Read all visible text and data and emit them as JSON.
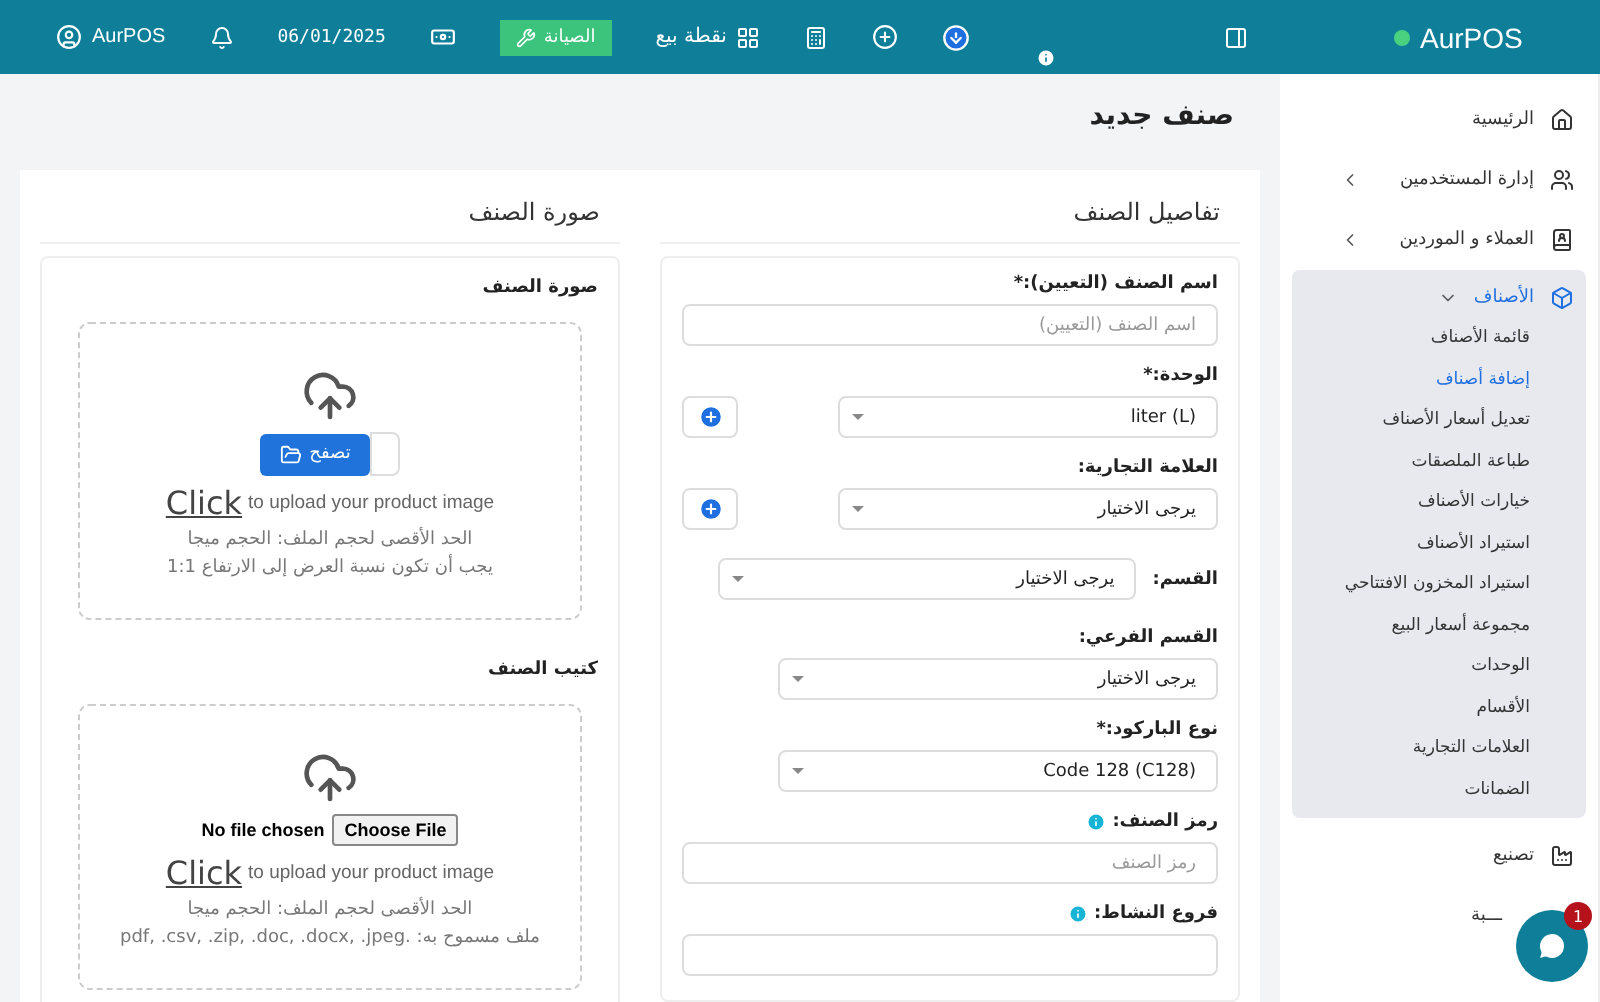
{
  "header": {
    "user": "AurPOS",
    "date": "06/01/2025",
    "maintenance_button": "الصيانة",
    "pos_link": "نقطة بيع",
    "logo": "AurPOS"
  },
  "page_title": "صنف جديد",
  "details": {
    "title": "تفاصيل الصنف",
    "fields": [
      {
        "kind": "text",
        "label": "اسم الصنف (التعيين):*",
        "placeholder": "اسم الصنف (التعيين)"
      },
      {
        "kind": "select-add",
        "label": "الوحدة:*",
        "value": "liter (L)"
      },
      {
        "kind": "select-add",
        "label": "العلامة التجارية:",
        "value": "يرجى الاختيار"
      },
      {
        "kind": "select-inline",
        "label": "القسم:",
        "value": "يرجى الاختيار"
      },
      {
        "kind": "select",
        "label": "القسم الفرعي:",
        "value": "يرجى الاختيار"
      },
      {
        "kind": "select",
        "label": "نوع الباركود:*",
        "value": "Code 128 (C128)"
      },
      {
        "kind": "text",
        "label": "رمز الصنف:",
        "placeholder": "رمز الصنف",
        "info": true
      },
      {
        "kind": "text",
        "label": "فروع النشاط:",
        "info": true
      }
    ]
  },
  "image": {
    "title": "صورة الصنف",
    "uploads": [
      {
        "kind": "browse",
        "label": "صورة الصنف",
        "button": "تصفح",
        "link": "Click",
        "hint": "to upload your product image",
        "notes": [
          "الحد الأقصى لحجم الملف: الحجم ميجا",
          "يجب أن تكون نسبة العرض إلى الارتفاع 1:1"
        ]
      },
      {
        "kind": "file",
        "label": "كتيب الصنف",
        "file_status": "No file chosen",
        "button": "Choose File",
        "link": "Click",
        "hint": "to upload your product image",
        "notes": [
          "الحد الأقصى لحجم الملف: الحجم ميجا",
          "ملف مسموح به: .pdf, .csv, .zip, .doc, .docx, .jpeg"
        ]
      }
    ]
  },
  "sidebar": {
    "items": [
      {
        "label": "الرئيسية"
      },
      {
        "label": "إدارة المستخدمين",
        "expanded": false
      },
      {
        "label": "العملاء و الموردين",
        "expanded": false
      },
      {
        "label": "الأصناف",
        "expanded": true,
        "children": [
          {
            "label": "قائمة الأصناف",
            "selected": false
          },
          {
            "label": "إضافة أصناف",
            "selected": true
          },
          {
            "label": "تعديل أسعار الأصناف",
            "selected": false
          },
          {
            "label": "طباعة الملصقات",
            "selected": false
          },
          {
            "label": "خيارات الأصناف",
            "selected": false
          },
          {
            "label": "استيراد الأصناف",
            "selected": false
          },
          {
            "label": "استيراد المخزون الافتتاحي",
            "selected": false
          },
          {
            "label": "مجموعة أسعار البيع",
            "selected": false
          },
          {
            "label": "الوحدات",
            "selected": false
          },
          {
            "label": "الأقسام",
            "selected": false
          },
          {
            "label": "العلامات التجارية",
            "selected": false
          },
          {
            "label": "الضمانات",
            "selected": false
          }
        ]
      },
      {
        "label": "تصنيع"
      },
      {
        "label": "ـــبة"
      }
    ]
  },
  "chat": {
    "badge": "1"
  }
}
